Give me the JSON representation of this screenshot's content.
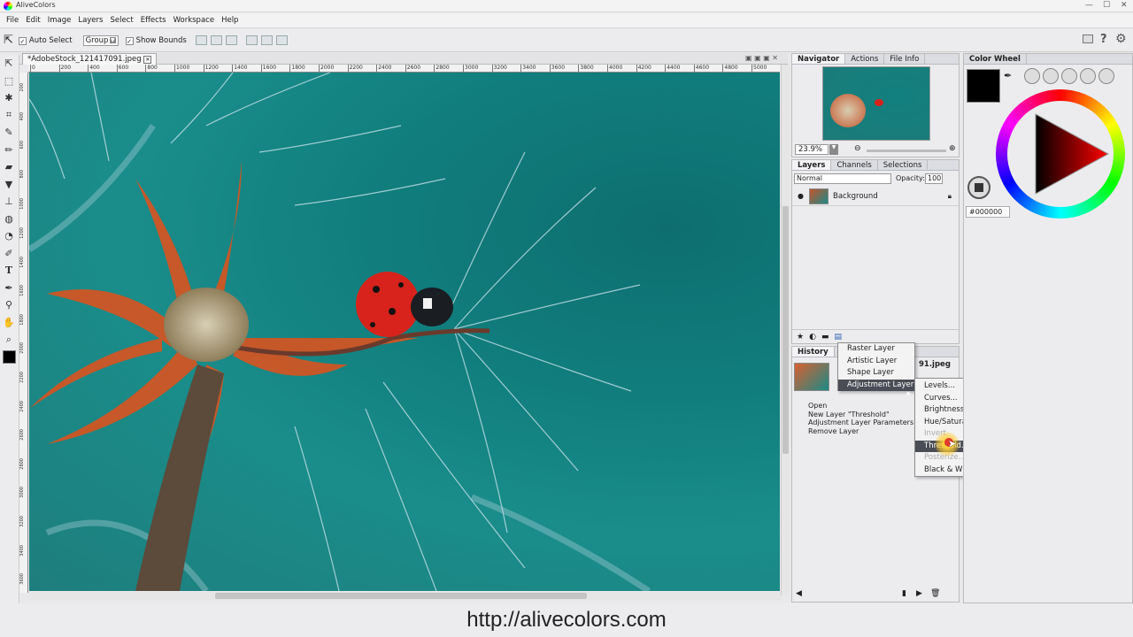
{
  "app": {
    "title": "AliveColors"
  },
  "menubar": [
    "File",
    "Edit",
    "Image",
    "Layers",
    "Select",
    "Effects",
    "Workspace",
    "Help"
  ],
  "options": {
    "auto_select": "Auto Select",
    "group_value": "Group",
    "show_bounds": "Show Bounds"
  },
  "document": {
    "tab_title": "*AdobeStock_121417091.jpeg"
  },
  "ruler": {
    "top_ticks": [
      "0",
      "200",
      "400",
      "600",
      "800",
      "1000",
      "1200",
      "1400",
      "1600",
      "1800",
      "2000",
      "2200",
      "2400",
      "2600",
      "2800",
      "3000",
      "3200",
      "3400",
      "3600",
      "3800",
      "4000",
      "4200",
      "4400",
      "4600",
      "4800",
      "5000",
      "5200"
    ],
    "left_ticks": [
      "200",
      "400",
      "600",
      "800",
      "1000",
      "1200",
      "1400",
      "1600",
      "1800",
      "2000",
      "2200",
      "2400",
      "2600",
      "2800",
      "3000",
      "3200",
      "3400",
      "3600"
    ]
  },
  "navigator": {
    "tabs": [
      "Navigator",
      "Actions",
      "File Info"
    ],
    "zoom": "23.9%"
  },
  "layers": {
    "tabs": [
      "Layers",
      "Channels",
      "Selections"
    ],
    "blend_mode": "Normal",
    "opacity_label": "Opacity:",
    "opacity_value": "100",
    "items": [
      {
        "name": "Background"
      }
    ]
  },
  "history": {
    "tab": "History",
    "file_partial": "91.jpeg",
    "items": [
      "Open",
      "New Layer \"Threshold\"",
      "Adjustment Layer Parameters",
      "Remove Layer"
    ]
  },
  "new_layer_menu": [
    "Raster Layer",
    "Artistic Layer",
    "Shape Layer",
    "Adjustment Layer"
  ],
  "adjustment_submenu": [
    {
      "label": "Levels..."
    },
    {
      "label": "Curves..."
    },
    {
      "label": "Brightness/Contrast..."
    },
    {
      "label": "Hue/Saturation..."
    },
    {
      "label": "Invert"
    },
    {
      "label": "Threshold..."
    },
    {
      "label": "Posterize..."
    },
    {
      "label": "Black & White..."
    }
  ],
  "adjustment_selected": "Threshold...",
  "color_wheel": {
    "title": "Color Wheel",
    "hex": "#000000",
    "current_color": "#000000"
  },
  "footer": {
    "url": "http://alivecolors.com"
  }
}
